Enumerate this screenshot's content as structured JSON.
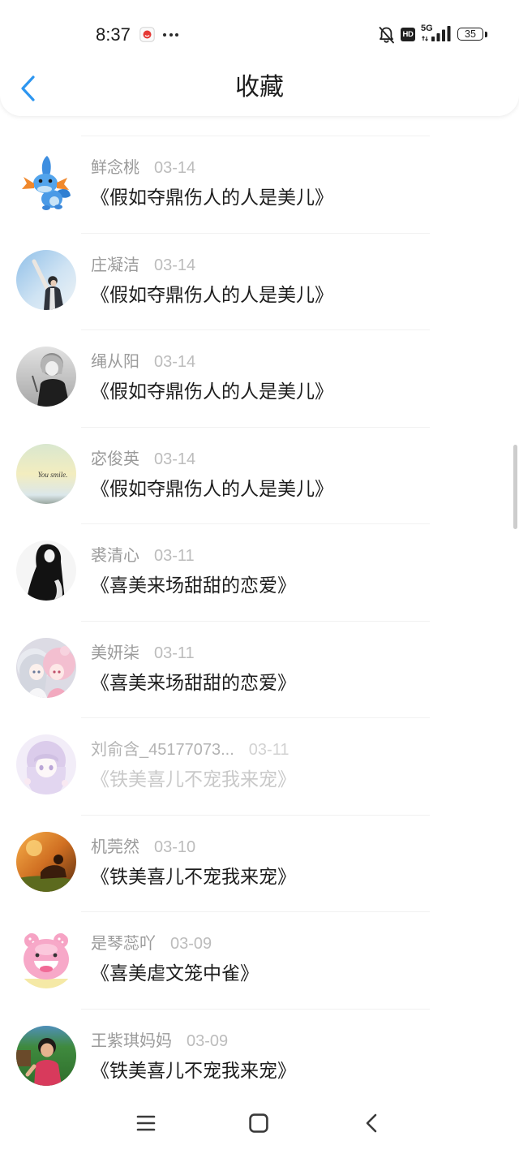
{
  "status_bar": {
    "time": "8:37",
    "hd_label": "HD",
    "network_type": "5G",
    "battery_level": "35",
    "signal_bars": 4,
    "signal_bars_max": 4,
    "icons": [
      "app-notification-icon",
      "more-dots-icon",
      "bell-off-icon",
      "hd-icon",
      "signal-icon",
      "battery-icon"
    ]
  },
  "header": {
    "title": "收藏",
    "back_icon": "chevron-left-icon"
  },
  "favorites": [
    {
      "name": "鲜念桃",
      "date": "03-14",
      "title": "《假如夺鼎伤人的人是美儿》"
    },
    {
      "name": "庄凝洁",
      "date": "03-14",
      "title": "《假如夺鼎伤人的人是美儿》"
    },
    {
      "name": "绳从阳",
      "date": "03-14",
      "title": "《假如夺鼎伤人的人是美儿》"
    },
    {
      "name": "宓俊英",
      "date": "03-14",
      "title": "《假如夺鼎伤人的人是美儿》",
      "avatar_text": "You smile."
    },
    {
      "name": "裘清心",
      "date": "03-11",
      "title": "《喜美来场甜甜的恋爱》"
    },
    {
      "name": "美妍柒",
      "date": "03-11",
      "title": "《喜美来场甜甜的恋爱》"
    },
    {
      "name": "刘俞含_45177073...",
      "date": "03-11",
      "title": "《铁美喜儿不宠我来宠》",
      "dimmed": true
    },
    {
      "name": "机莞然",
      "date": "03-10",
      "title": "《铁美喜儿不宠我来宠》"
    },
    {
      "name": "是琴蕊吖",
      "date": "03-09",
      "title": "《喜美虐文笼中雀》"
    },
    {
      "name": "王紫琪妈妈",
      "date": "03-09",
      "title": "《铁美喜儿不宠我来宠》"
    }
  ],
  "nav_bar": {
    "icons": [
      "menu-icon",
      "home-square-icon",
      "back-icon"
    ]
  },
  "colors": {
    "accent": "#2d96f0",
    "name_text": "#9b9b9b",
    "date_text": "#bcbcbc",
    "title_text": "#1e1e1e",
    "divider": "#f1f1f1"
  }
}
